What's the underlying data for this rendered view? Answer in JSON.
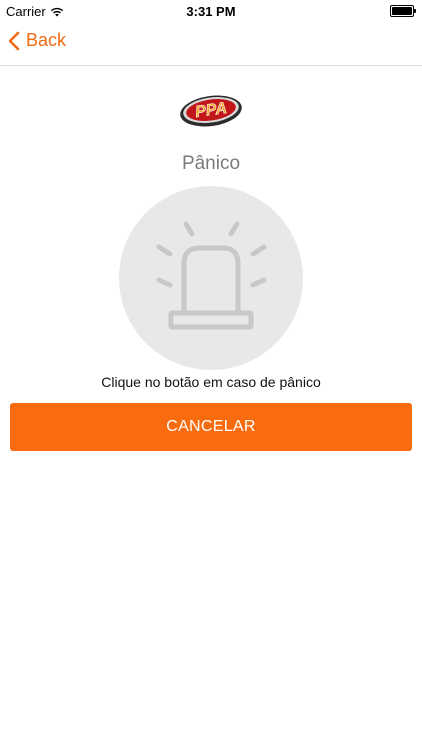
{
  "status_bar": {
    "carrier": "Carrier",
    "time": "3:31 PM"
  },
  "nav": {
    "back_label": "Back"
  },
  "logo": {
    "text": "PPA",
    "colors": {
      "outer": "#2b2b2b",
      "ring": "#c2161a",
      "letters": "#f5a020"
    }
  },
  "page": {
    "title": "Pânico",
    "instruction": "Clique no botão em caso de pânico",
    "cancel_label": "CANCELAR"
  },
  "colors": {
    "accent": "#f86c0f",
    "panic_circle": "#e8e8e8",
    "siren_stroke": "#c8c8c8"
  }
}
